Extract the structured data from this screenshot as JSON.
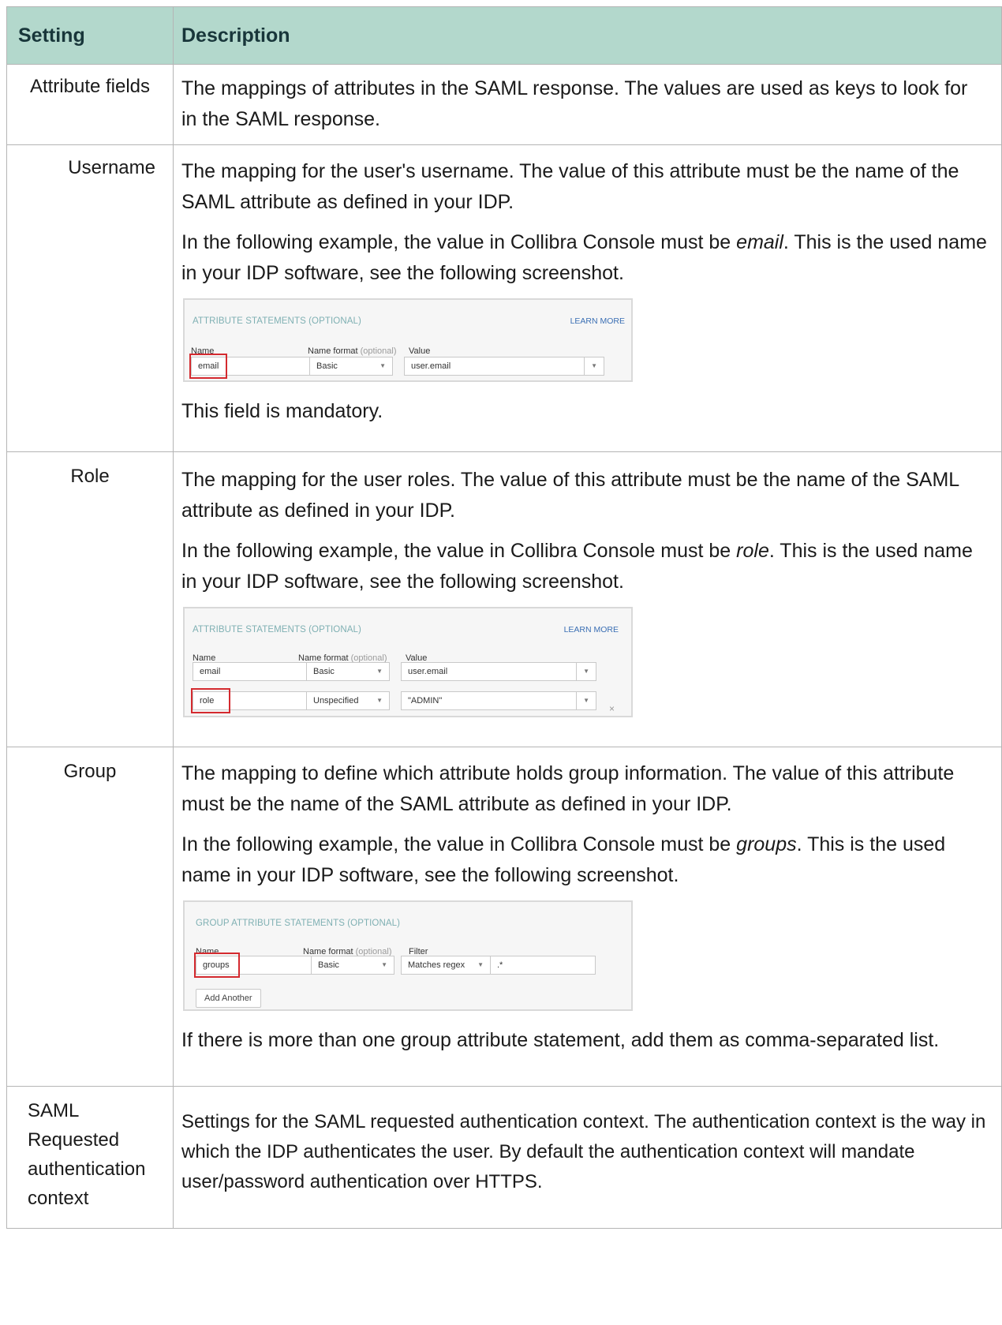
{
  "table": {
    "headers": [
      "Setting",
      "Description"
    ]
  },
  "rows": {
    "attribute_fields": {
      "setting": "Attribute fields",
      "desc": "The mappings of attributes in the SAML response. The values are used as keys to look for in the SAML response."
    },
    "username": {
      "setting": "Username",
      "p1": "The mapping for the user's username. The value of this attribute must be the name of the SAML attribute as defined in your IDP.",
      "p2_pre": "In the following example, the value in Collibra Console must be ",
      "p2_em": "email",
      "p2_post": ". This is the used name in your IDP software, see the following screenshot.",
      "p3": "This field is mandatory."
    },
    "role": {
      "setting": "Role",
      "p1": "The mapping for the user roles. The value of this attribute must be the name of the SAML attribute as defined in your IDP.",
      "p2_pre": "In the following example, the value in Collibra Console must be ",
      "p2_em": "role",
      "p2_post": ". This is the used name in your IDP software, see the following screenshot."
    },
    "group": {
      "setting": "Group",
      "p1": "The mapping to define which attribute holds group information. The value of this attribute must be the name of the SAML attribute as defined in your IDP.",
      "p2_pre": "In the following example, the value in Collibra Console must be ",
      "p2_em": "groups",
      "p2_post": ". This is the used name in your IDP software, see the following screenshot.",
      "p3": "If there is more than one group attribute statement, add them as comma-separated list."
    },
    "saml_context": {
      "setting": "SAML Requested authentication context",
      "desc": "Settings for the SAML requested authentication context. The authentication context is the way in which the IDP authenticates the user. By default the authentication context will mandate user/password authentication over HTTPS."
    }
  },
  "shot1": {
    "header": "ATTRIBUTE STATEMENTS (OPTIONAL)",
    "learn_more": "LEARN MORE",
    "col_name": "Name",
    "col_format": "Name format",
    "col_format_opt": "(optional)",
    "col_value": "Value",
    "name": "email",
    "format": "Basic",
    "value": "user.email"
  },
  "shot2": {
    "header": "ATTRIBUTE STATEMENTS (OPTIONAL)",
    "learn_more": "LEARN MORE",
    "col_name": "Name",
    "col_format": "Name format",
    "col_format_opt": "(optional)",
    "col_value": "Value",
    "row1_name": "email",
    "row1_format": "Basic",
    "row1_value": "user.email",
    "row2_name": "role",
    "row2_format": "Unspecified",
    "row2_value": "\"ADMIN\"",
    "remove": "×"
  },
  "shot3": {
    "header": "GROUP ATTRIBUTE STATEMENTS (OPTIONAL)",
    "col_name": "Name",
    "col_format": "Name format",
    "col_format_opt": "(optional)",
    "col_filter": "Filter",
    "name": "groups",
    "format": "Basic",
    "filter_type": "Matches regex",
    "filter_value": ".*",
    "add_another": "Add Another"
  },
  "icons": {
    "dropdown_arrow": "▼"
  },
  "colors": {
    "header_bg": "#b3d8cc",
    "highlight": "#d42a2f",
    "panel_header": "#7fb0b3"
  }
}
